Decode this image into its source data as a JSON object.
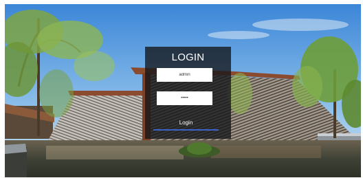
{
  "login": {
    "title": "LOGIN",
    "username_value": "admin",
    "password_value": "•••••",
    "button_label": "Login"
  },
  "colors": {
    "panel": "#16181c",
    "accent": "#3d63c9",
    "text": "#ffffff"
  }
}
